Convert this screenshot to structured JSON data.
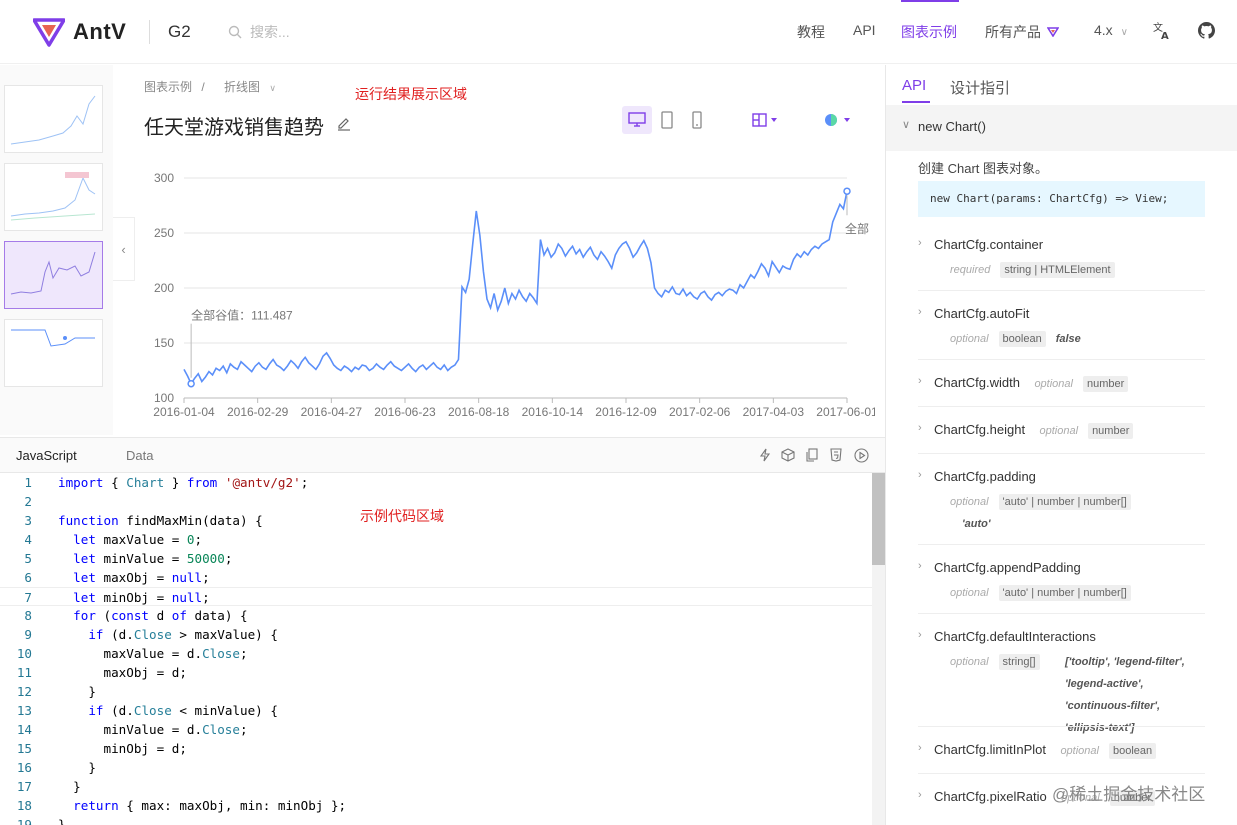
{
  "header": {
    "logo_text": "AntV",
    "product": "G2",
    "search_placeholder": "搜索...",
    "nav": [
      "教程",
      "API",
      "图表示例",
      "所有产品"
    ],
    "version": "4.x"
  },
  "chart_page": {
    "breadcrumb": [
      "图表示例",
      "折线图"
    ],
    "title": "任天堂游戏销售趋势",
    "annotation_result": "运行结果展示区域",
    "annotation_code": "示例代码区域"
  },
  "chart_data": {
    "type": "line",
    "x_ticks": [
      "2016-01-04",
      "2016-02-29",
      "2016-04-27",
      "2016-06-23",
      "2016-08-18",
      "2016-10-14",
      "2016-12-09",
      "2017-02-06",
      "2017-04-03",
      "2017-06-01"
    ],
    "y_ticks": [
      100,
      150,
      200,
      250,
      300
    ],
    "ylim": [
      100,
      300
    ],
    "annotation_min": "全部谷值：111.487",
    "annotation_max": "全部",
    "grid": true,
    "color": "#5b8ff9",
    "y_values": [
      126,
      120,
      113,
      118,
      122,
      115,
      119,
      124,
      121,
      127,
      125,
      129,
      123,
      131,
      128,
      126,
      133,
      130,
      127,
      124,
      129,
      132,
      128,
      126,
      131,
      135,
      130,
      128,
      125,
      129,
      134,
      131,
      127,
      133,
      137,
      132,
      129,
      126,
      131,
      138,
      141,
      136,
      130,
      127,
      125,
      129,
      127,
      124,
      128,
      126,
      130,
      129,
      125,
      127,
      131,
      128,
      126,
      130,
      133,
      129,
      127,
      125,
      128,
      131,
      127,
      124,
      128,
      130,
      126,
      129,
      132,
      128,
      126,
      130,
      125,
      128,
      130,
      135,
      201,
      196,
      208,
      240,
      270,
      248,
      215,
      190,
      182,
      195,
      180,
      188,
      200,
      186,
      195,
      190,
      198,
      192,
      188,
      195,
      191,
      186,
      244,
      230,
      236,
      228,
      232,
      240,
      236,
      229,
      234,
      238,
      231,
      235,
      228,
      233,
      237,
      230,
      226,
      233,
      229,
      224,
      218,
      230,
      236,
      240,
      242,
      236,
      228,
      232,
      238,
      243,
      236,
      223,
      200,
      195,
      192,
      198,
      196,
      201,
      195,
      194,
      199,
      193,
      196,
      192,
      190,
      195,
      197,
      192,
      189,
      194,
      196,
      193,
      197,
      199,
      198,
      195,
      203,
      200,
      206,
      212,
      209,
      215,
      222,
      218,
      211,
      224,
      219,
      214,
      220,
      218,
      217,
      226,
      231,
      228,
      233,
      230,
      235,
      238,
      236,
      240,
      242,
      244,
      260,
      268,
      276,
      272,
      288
    ]
  },
  "editor": {
    "tabs": [
      "JavaScript",
      "Data"
    ],
    "lines": [
      [
        {
          "t": "import",
          "c": "kw"
        },
        {
          "t": " { "
        },
        {
          "t": "Chart",
          "c": "prop"
        },
        {
          "t": " } "
        },
        {
          "t": "from",
          "c": "kw"
        },
        {
          "t": " "
        },
        {
          "t": "'@antv/g2'",
          "c": "str"
        },
        {
          "t": ";"
        }
      ],
      [],
      [
        {
          "t": "function",
          "c": "kw"
        },
        {
          "t": " findMaxMin(data) {"
        }
      ],
      [
        {
          "t": "  "
        },
        {
          "t": "let",
          "c": "kw"
        },
        {
          "t": " maxValue = "
        },
        {
          "t": "0",
          "c": "num"
        },
        {
          "t": ";"
        }
      ],
      [
        {
          "t": "  "
        },
        {
          "t": "let",
          "c": "kw"
        },
        {
          "t": " minValue = "
        },
        {
          "t": "50000",
          "c": "num"
        },
        {
          "t": ";"
        }
      ],
      [
        {
          "t": "  "
        },
        {
          "t": "let",
          "c": "kw"
        },
        {
          "t": " maxObj = "
        },
        {
          "t": "null",
          "c": "kw"
        },
        {
          "t": ";"
        }
      ],
      [
        {
          "t": "  "
        },
        {
          "t": "let",
          "c": "kw"
        },
        {
          "t": " minObj = "
        },
        {
          "t": "null",
          "c": "kw"
        },
        {
          "t": ";"
        }
      ],
      [
        {
          "t": "  "
        },
        {
          "t": "for",
          "c": "kw"
        },
        {
          "t": " ("
        },
        {
          "t": "const",
          "c": "kw"
        },
        {
          "t": " d "
        },
        {
          "t": "of",
          "c": "kw"
        },
        {
          "t": " data) {"
        }
      ],
      [
        {
          "t": "    "
        },
        {
          "t": "if",
          "c": "kw"
        },
        {
          "t": " (d."
        },
        {
          "t": "Close",
          "c": "prop"
        },
        {
          "t": " > maxValue) {"
        }
      ],
      [
        {
          "t": "      maxValue = d."
        },
        {
          "t": "Close",
          "c": "prop"
        },
        {
          "t": ";"
        }
      ],
      [
        {
          "t": "      maxObj = d;"
        }
      ],
      [
        {
          "t": "    }"
        }
      ],
      [
        {
          "t": "    "
        },
        {
          "t": "if",
          "c": "kw"
        },
        {
          "t": " (d."
        },
        {
          "t": "Close",
          "c": "prop"
        },
        {
          "t": " < minValue) {"
        }
      ],
      [
        {
          "t": "      minValue = d."
        },
        {
          "t": "Close",
          "c": "prop"
        },
        {
          "t": ";"
        }
      ],
      [
        {
          "t": "      minObj = d;"
        }
      ],
      [
        {
          "t": "    }"
        }
      ],
      [
        {
          "t": "  }"
        }
      ],
      [
        {
          "t": "  "
        },
        {
          "t": "return",
          "c": "kw"
        },
        {
          "t": " { max: maxObj, min: minObj };"
        }
      ],
      [
        {
          "t": "}"
        }
      ]
    ]
  },
  "api_panel": {
    "tabs": [
      "API",
      "设计指引"
    ],
    "section": "new Chart()",
    "desc": "创建 Chart 图表对象。",
    "signature": "new Chart(params: ChartCfg) => View;",
    "items": [
      {
        "name": "ChartCfg.container",
        "req": "required",
        "type": "string | HTMLElement",
        "def": ""
      },
      {
        "name": "ChartCfg.autoFit",
        "req": "optional",
        "type": "boolean",
        "def": "false"
      },
      {
        "name": "ChartCfg.width",
        "req": "optional",
        "type": "number",
        "def": ""
      },
      {
        "name": "ChartCfg.height",
        "req": "optional",
        "type": "number",
        "def": ""
      },
      {
        "name": "ChartCfg.padding",
        "req": "optional",
        "type": "'auto' | number | number[]",
        "def": "'auto'"
      },
      {
        "name": "ChartCfg.appendPadding",
        "req": "optional",
        "type": "'auto' | number | number[]",
        "def": ""
      },
      {
        "name": "ChartCfg.defaultInteractions",
        "req": "optional",
        "type": "string[]",
        "def": "['tooltip', 'legend-filter', 'legend-active', 'continuous-filter', 'ellipsis-text']"
      },
      {
        "name": "ChartCfg.limitInPlot",
        "req": "optional",
        "type": "boolean",
        "def": ""
      },
      {
        "name": "ChartCfg.pixelRatio",
        "req": "optional",
        "type": "number",
        "def": ""
      }
    ]
  },
  "watermark": "@稀土掘金技术社区"
}
